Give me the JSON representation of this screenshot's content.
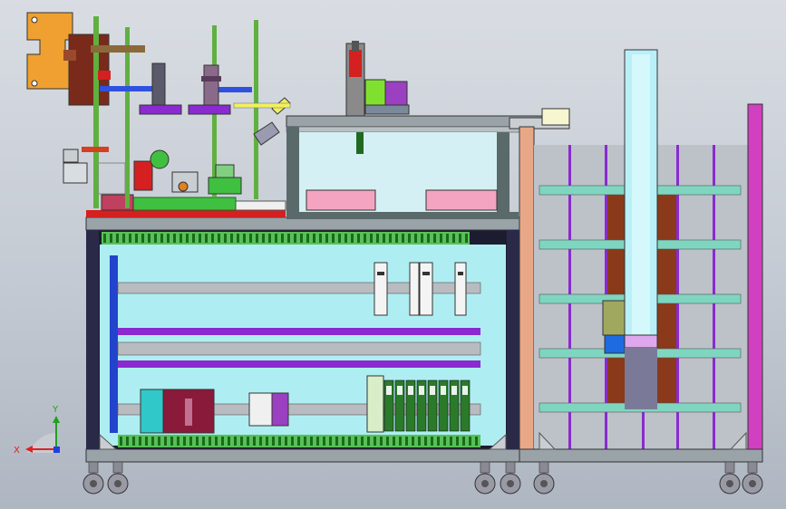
{
  "viewport": {
    "background_top": "#d9dde3",
    "background_bottom": "#aeb6c1"
  },
  "axes": {
    "x_label": "X",
    "y_label": "Y",
    "x_color": "#e02020",
    "y_color": "#20a020",
    "z_color": "#2040e0"
  },
  "colors": {
    "frame_dark": "#1c1c30",
    "frame_gray": "#9aa3a8",
    "frame_purple": "#7a2aa6",
    "cabinet_interior": "#aeeef2",
    "rail_gray": "#b8bcc0",
    "shelf_teal": "#7fd6c0",
    "tower_interior": "#8a3a1a",
    "column_cyan": "#b9f0f7",
    "pink_tray": "#f4a4c0",
    "table_red": "#d42020",
    "plate_green": "#40c040",
    "rod_green": "#60b040",
    "fixture_orange": "#f0a030",
    "caster_gray": "#9a9aa6"
  },
  "components": {
    "shelf_levels": 5,
    "drive_modules": 8,
    "casters": 6
  }
}
